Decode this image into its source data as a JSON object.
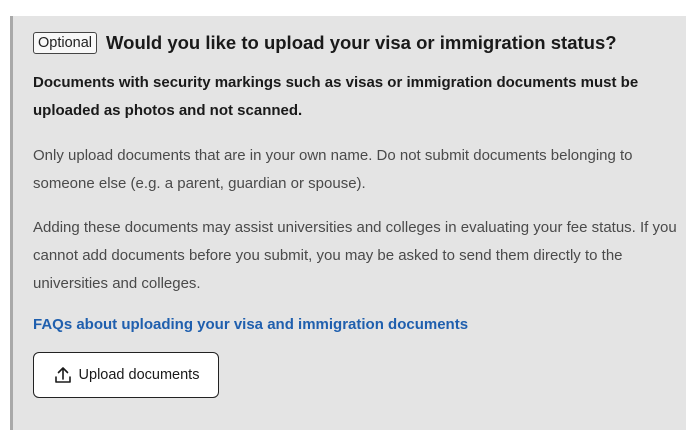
{
  "section": {
    "optional_tag": "Optional",
    "title": "Would you like to upload your visa or immigration status?",
    "bold_note": "Documents with security markings such as visas or immigration documents must be uploaded as photos and not scanned.",
    "paragraphs": [
      "Only upload documents that are in your own name. Do not submit documents belonging to someone else (e.g. a parent, guardian or spouse).",
      "Adding these documents may assist universities and colleges in evaluating your fee status. If you cannot add documents before you submit, you may be asked to send them directly to the universities and colleges."
    ],
    "faq_link": "FAQs about uploading your visa and immigration documents",
    "upload_button": {
      "label": "Upload documents",
      "icon": "upload-icon"
    }
  },
  "colors": {
    "panel_background": "#e4e4e4",
    "panel_border": "#a9a9a9",
    "link": "#1f5fae",
    "body_text": "#4a4a4a"
  }
}
